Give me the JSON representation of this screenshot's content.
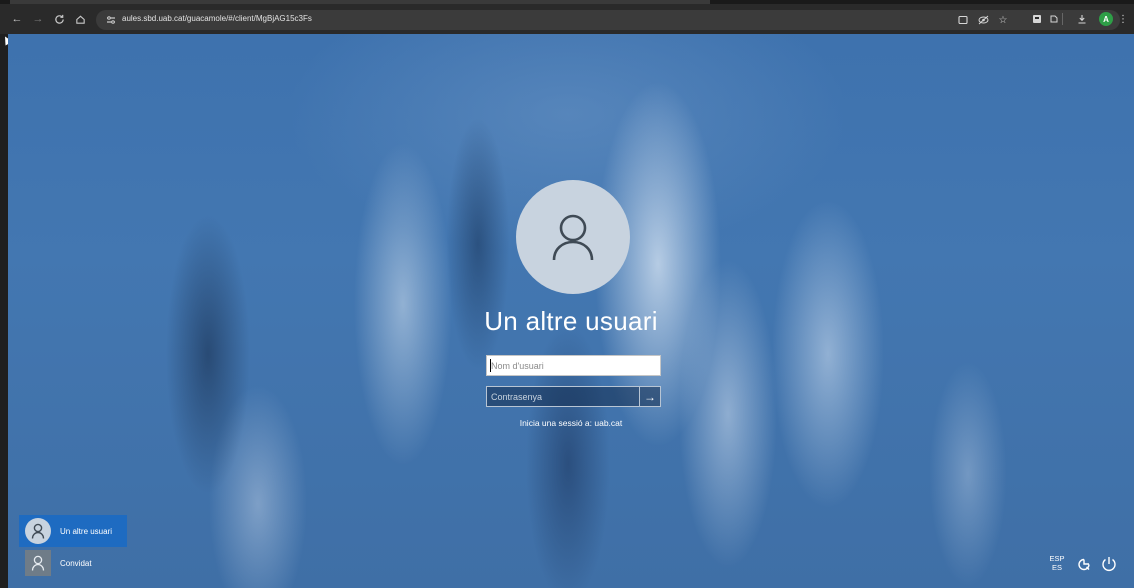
{
  "browser": {
    "url": "aules.sbd.uab.cat/guacamole/#/client/MgBjAG15c3Fs",
    "profile_initial": "A",
    "icons": {
      "back": "arrow-left-icon",
      "forward": "arrow-right-icon",
      "reload": "reload-icon",
      "home": "home-icon",
      "site_info": "tune-icon",
      "screencast": "screencast-icon",
      "eye_off": "eye-off-icon",
      "bookmark": "star-icon",
      "extension": "extension-icon",
      "sidebar": "sidebar-icon",
      "download": "download-icon",
      "menu": "kebab-menu-icon"
    }
  },
  "login": {
    "title": "Un altre usuari",
    "username_placeholder": "Nom d'usuari",
    "password_placeholder": "Contrasenya",
    "submit_icon": "arrow-right-icon",
    "domain_hint": "Inicia una sessió a: uab.cat"
  },
  "users": [
    {
      "name": "Un altre usuari",
      "selected": true
    },
    {
      "name": "Convidat",
      "selected": false
    }
  ],
  "tray": {
    "language_top": "ESP",
    "language_bottom": "ES",
    "accessibility_icon": "accessibility-icon",
    "power_icon": "power-icon"
  },
  "colors": {
    "selected_user": "#1e6bc1",
    "wallpaper": "#4377b1"
  }
}
